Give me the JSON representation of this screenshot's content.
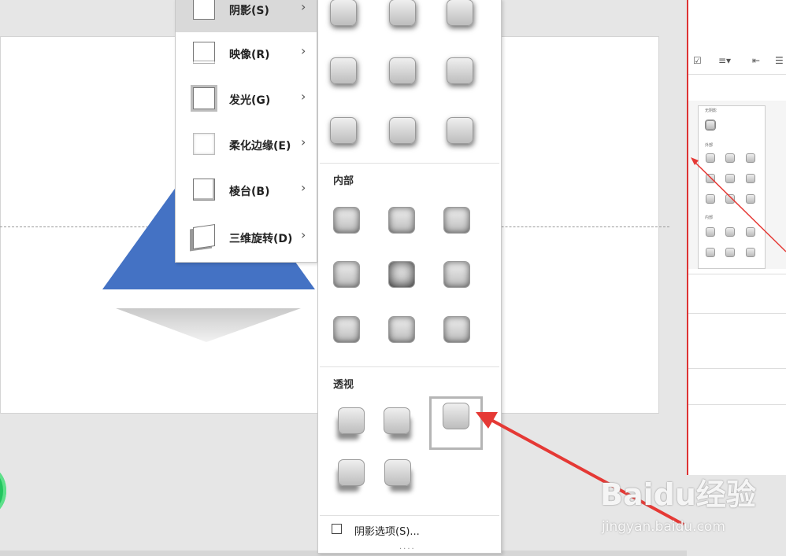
{
  "submenu": {
    "items": [
      {
        "label": "阴影(S)",
        "icon": "shadow-icon",
        "active": true
      },
      {
        "label": "映像(R)",
        "icon": "reflection-icon"
      },
      {
        "label": "发光(G)",
        "icon": "glow-icon"
      },
      {
        "label": "柔化边缘(E)",
        "icon": "soft-edges-icon"
      },
      {
        "label": "棱台(B)",
        "icon": "bevel-icon"
      },
      {
        "label": "三维旋转(D)",
        "icon": "3d-rotation-icon"
      }
    ]
  },
  "gallery": {
    "inner_title": "内部",
    "perspective_title": "透视",
    "options_label": "阴影选项(S)...",
    "grip": "....",
    "selected": "perspective-3"
  },
  "slide": {
    "shape_color": "#4472c4"
  },
  "watermark": {
    "brand": "Baidu经验",
    "url": "jingyan.baidu.com"
  },
  "right_window": {
    "mini_label_none": "无阴影",
    "mini_label_outer": "外部",
    "mini_label_inner": "内部"
  },
  "colors": {
    "arrow": "#e53935",
    "selection": "#b5b5b5"
  }
}
